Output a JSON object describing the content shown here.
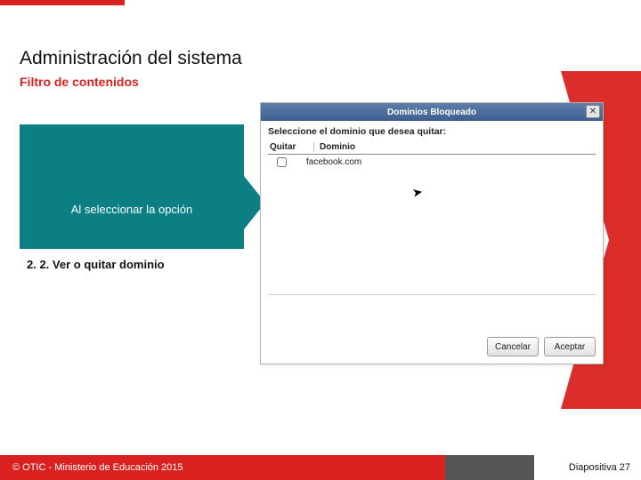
{
  "slide": {
    "heading": "Administración del sistema",
    "subheading": "Filtro de contenidos"
  },
  "callout": {
    "line1": "Al seleccionar la opción",
    "line2": "2. 2. Ver o quitar dominio"
  },
  "dialog": {
    "title": "Dominios Bloqueado",
    "instruction": "Seleccione el dominio que desea quitar:",
    "columns": {
      "remove": "Quitar",
      "domain": "Dominio"
    },
    "row0_domain": "facebook.com",
    "buttons": {
      "cancel": "Cancelar",
      "ok": "Aceptar"
    },
    "close_glyph": "✕"
  },
  "footer": {
    "copyright": "© OTIC - Ministerio de Educación 2015",
    "page_label": "Diapositiva 27"
  }
}
